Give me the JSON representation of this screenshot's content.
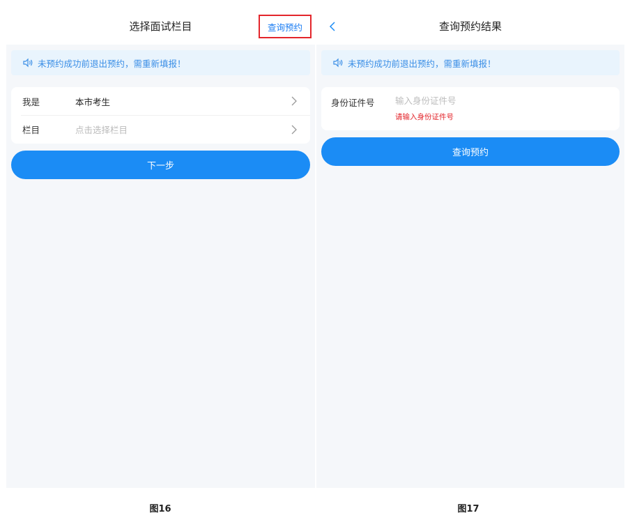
{
  "left_screen": {
    "header": {
      "title": "选择面试栏目",
      "action_label": "查询预约"
    },
    "notice": "未预约成功前退出预约，需重新填报！",
    "form": {
      "rows": [
        {
          "label": "我是",
          "value": "本市考生"
        },
        {
          "label": "栏目",
          "placeholder": "点击选择栏目"
        }
      ]
    },
    "next_button": "下一步"
  },
  "right_screen": {
    "header": {
      "title": "查询预约结果"
    },
    "notice": "未预约成功前退出预约，需重新填报！",
    "id_field": {
      "label": "身份证件号",
      "placeholder": "输入身份证件号",
      "error": "请输入身份证件号"
    },
    "query_button": "查询预约"
  },
  "captions": {
    "left": "图16",
    "right": "图17"
  },
  "colors": {
    "primary": "#1b8cf5",
    "error": "#e3252b",
    "notice_bg": "#e9f4fd",
    "page_bg": "#f5f7fa"
  }
}
